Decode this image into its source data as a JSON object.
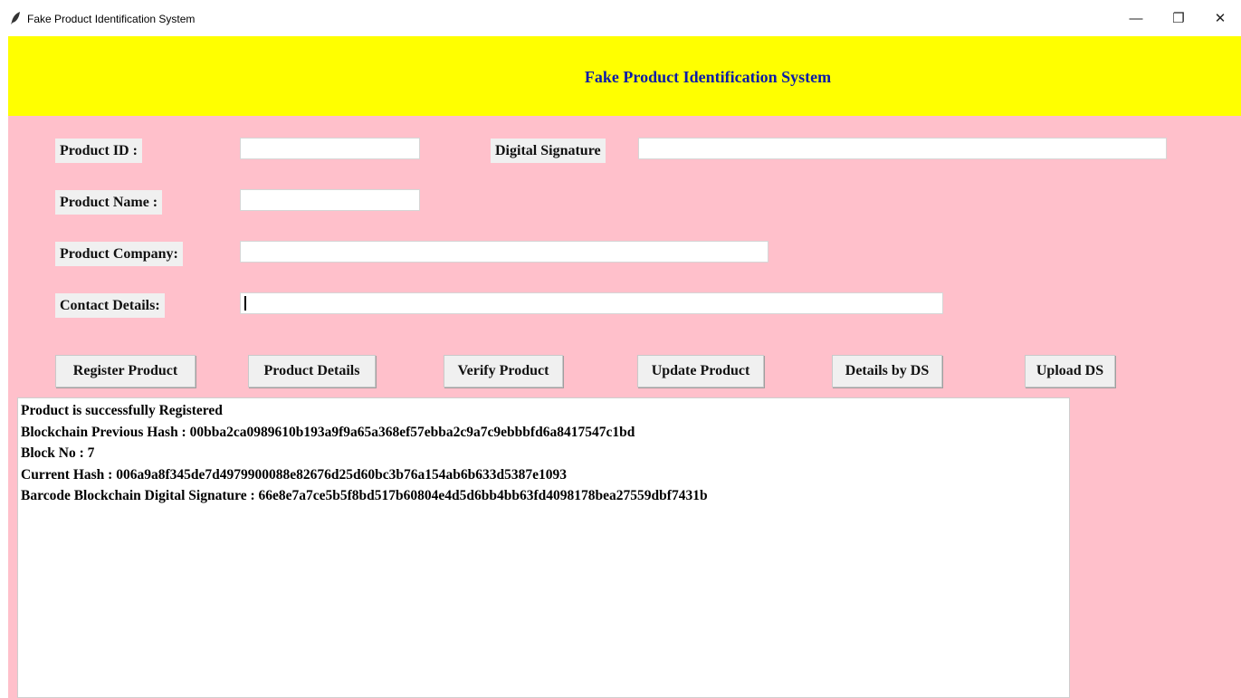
{
  "window": {
    "title": "Fake Product Identification System",
    "controls": {
      "minimize": "—",
      "restore": "❐",
      "close": "✕"
    }
  },
  "header": {
    "title": "Fake Product Identification System"
  },
  "form": {
    "product_id": {
      "label": "Product ID :",
      "value": ""
    },
    "digital_signature": {
      "label": "Digital Signature",
      "value": ""
    },
    "product_name": {
      "label": "Product Name :",
      "value": ""
    },
    "product_company": {
      "label": "Product Company:",
      "value": ""
    },
    "contact_details": {
      "label": "Contact Details:",
      "value": ""
    }
  },
  "buttons": {
    "register": "Register Product",
    "details": "Product Details",
    "verify": "Verify Product",
    "update": "Update Product",
    "details_by_ds": "Details by DS",
    "upload_ds": "Upload DS"
  },
  "output": {
    "lines": [
      "Product is successfully Registered",
      "Blockchain Previous Hash : 00bba2ca0989610b193a9f9a65a368ef57ebba2c9a7c9ebbbfd6a8417547c1bd",
      "Block No : 7",
      "Current Hash : 006a9a8f345de7d4979900088e82676d25d60bc3b76a154ab6b633d5387e1093",
      "Barcode Blockchain Digital Signature : 66e8e7a7ce5b5f8bd517b60804e4d5d6bb4bb63fd4098178bea27559dbf7431b"
    ]
  },
  "colors": {
    "header_bg": "#ffff00",
    "header_text": "#0b1ca8",
    "window_bg": "#ffc0cb",
    "label_bg": "#f0f0f0"
  }
}
